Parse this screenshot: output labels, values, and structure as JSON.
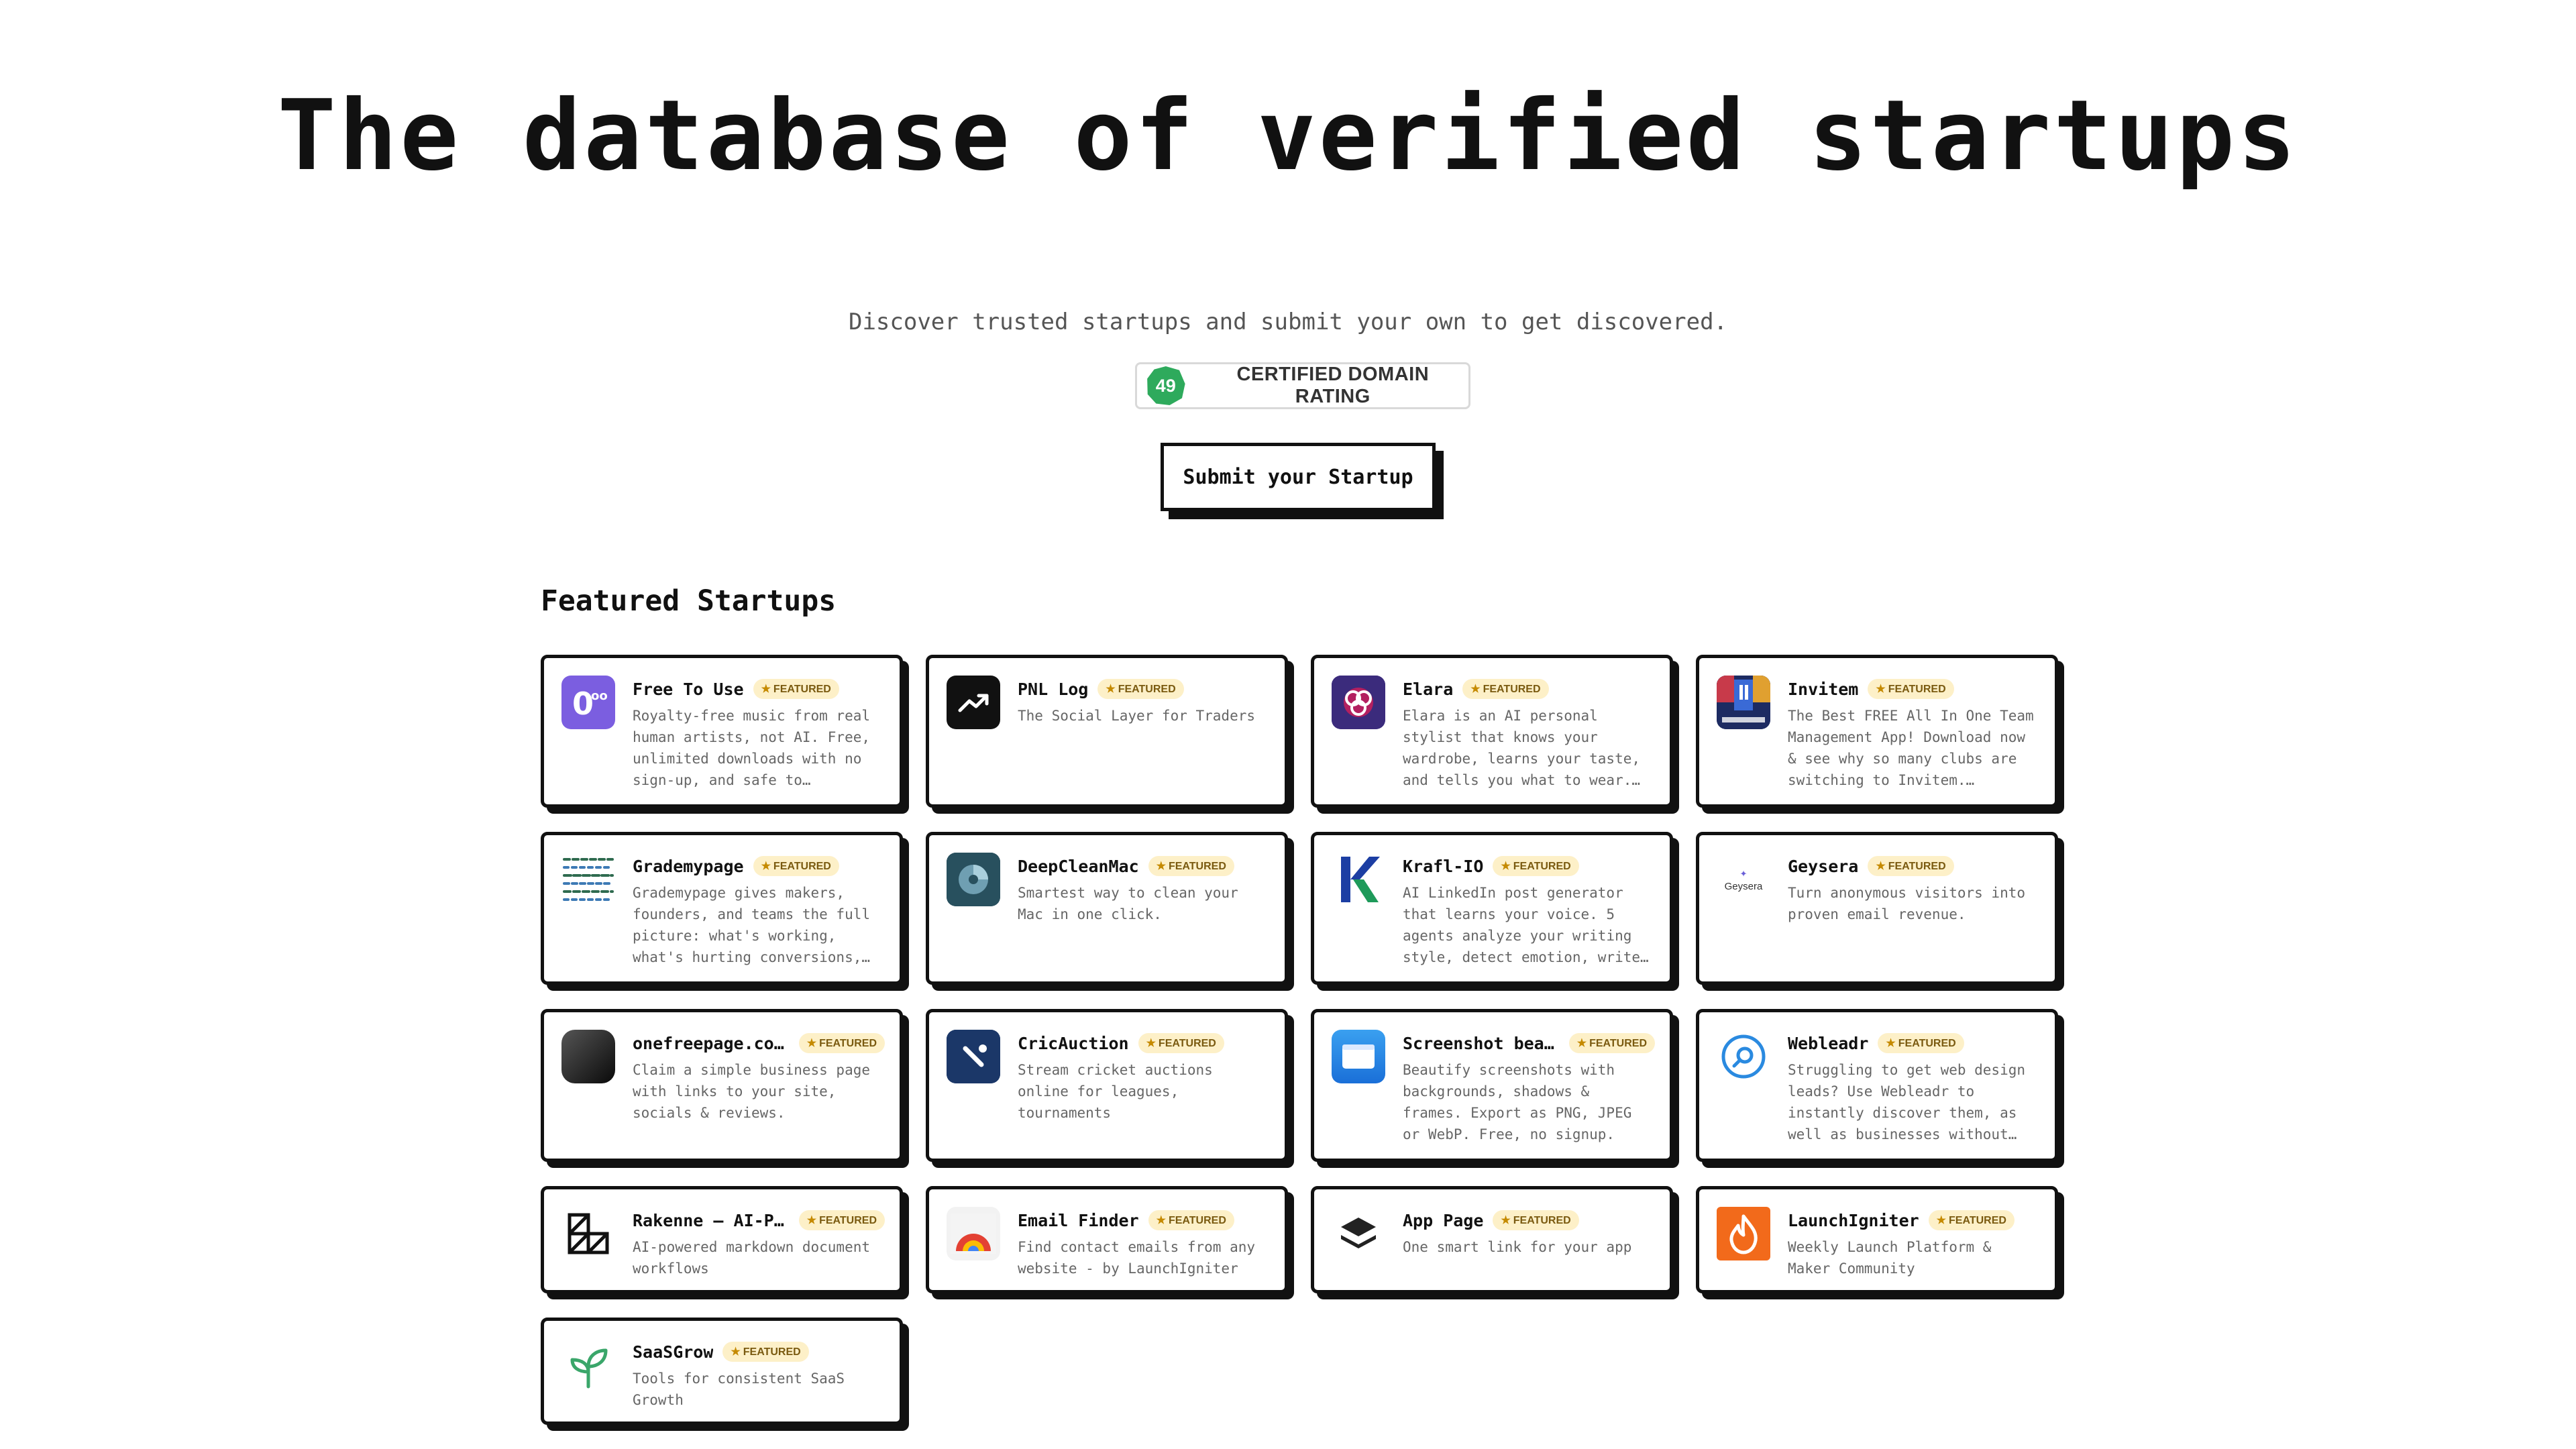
{
  "hero": {
    "title": "The database of verified startups",
    "subtitle": "Discover trusted startups and submit your own to get discovered.",
    "domain_rating_value": "49",
    "domain_rating_label": "CERTIFIED DOMAIN RATING",
    "submit_label": "Submit your Startup"
  },
  "featured": {
    "title": "Featured Startups",
    "badge_label": "FEATURED",
    "items": [
      {
        "name": "Free To Use",
        "desc": "Royalty-free music from real human artists, not AI. Free, unlimited downloads with no sign-up, and safe to monetize…",
        "icon": "music-note-icon"
      },
      {
        "name": "PNL Log",
        "desc": "The Social Layer for Traders",
        "icon": "trend-up-icon"
      },
      {
        "name": "Elara",
        "desc": "Elara is an AI personal stylist that knows your wardrobe, learns your taste, and tells you what to wear. The…",
        "icon": "elara-logo-icon"
      },
      {
        "name": "Invitem",
        "desc": "The Best FREE All In One Team Management App! Download now & see why so many clubs are switching to Invitem.…",
        "icon": "invitem-logo-icon"
      },
      {
        "name": "Grademypage",
        "desc": "Grademypage gives makers, founders, and teams the full picture: what's working, what's hurting conversions, and…",
        "icon": "grademypage-logo-icon"
      },
      {
        "name": "DeepCleanMac",
        "desc": "Smartest way to clean your Mac in one click.",
        "icon": "deepcleanmac-logo-icon"
      },
      {
        "name": "Krafl-IO",
        "desc": "AI LinkedIn post generator that learns your voice. 5 agents analyze your writing style, detect emotion, write, format,…",
        "icon": "krafl-logo-icon"
      },
      {
        "name": "Geysera",
        "desc": "Turn anonymous visitors into proven email revenue.",
        "icon": "geysera-logo-icon",
        "logo_text": "Geysera"
      },
      {
        "name": "onefreepage.com®",
        "desc": "Claim a simple business page with links to your site, socials & reviews.",
        "icon": "onefreepage-logo-icon"
      },
      {
        "name": "CricAuction",
        "desc": "Stream cricket auctions online for leagues, tournaments",
        "icon": "cricauction-logo-icon"
      },
      {
        "name": "Screenshot beau…",
        "desc": "Beautify screenshots with backgrounds, shadows & frames. Export as PNG, JPEG or WebP. Free, no signup.",
        "icon": "screenshot-window-icon"
      },
      {
        "name": "Webleadr",
        "desc": "Struggling to get web design leads? Use Webleadr to instantly discover them, as well as businesses without…",
        "icon": "webleadr-search-icon"
      },
      {
        "name": "Rakenne – AI-Po…",
        "desc": "AI-powered markdown document workflows",
        "icon": "rakenne-logo-icon"
      },
      {
        "name": "Email Finder",
        "desc": "Find contact emails from any website - by LaunchIgniter",
        "icon": "email-finder-logo-icon"
      },
      {
        "name": "App Page",
        "desc": "One smart link for your app",
        "icon": "layers-icon"
      },
      {
        "name": "LaunchIgniter",
        "desc": "Weekly Launch Platform & Maker Community",
        "icon": "flame-icon"
      },
      {
        "name": "SaaSGrow",
        "desc": "Tools for consistent SaaS Growth",
        "icon": "sprout-icon"
      }
    ]
  }
}
